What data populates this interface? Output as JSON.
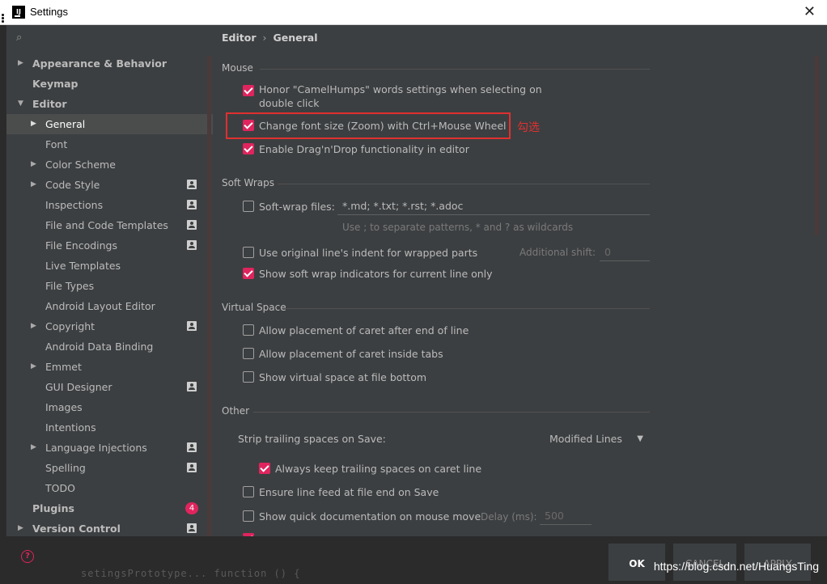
{
  "window": {
    "title": "Settings",
    "app_icon_letter": "IJ",
    "close_glyph": "✕"
  },
  "search": {
    "icon": "search-icon",
    "glyph": "⌕"
  },
  "sidebar": {
    "items": [
      {
        "label": "Appearance & Behavior"
      },
      {
        "label": "Keymap"
      },
      {
        "label": "Editor"
      },
      {
        "label": "General"
      },
      {
        "label": "Font"
      },
      {
        "label": "Color Scheme"
      },
      {
        "label": "Code Style"
      },
      {
        "label": "Inspections"
      },
      {
        "label": "File and Code Templates"
      },
      {
        "label": "File Encodings"
      },
      {
        "label": "Live Templates"
      },
      {
        "label": "File Types"
      },
      {
        "label": "Android Layout Editor"
      },
      {
        "label": "Copyright"
      },
      {
        "label": "Android Data Binding"
      },
      {
        "label": "Emmet"
      },
      {
        "label": "GUI Designer"
      },
      {
        "label": "Images"
      },
      {
        "label": "Intentions"
      },
      {
        "label": "Language Injections"
      },
      {
        "label": "Spelling"
      },
      {
        "label": "TODO"
      },
      {
        "label": "Plugins",
        "badge": "4"
      },
      {
        "label": "Version Control"
      }
    ]
  },
  "breadcrumb": {
    "part1": "Editor",
    "sep": "›",
    "part2": "General"
  },
  "mouse": {
    "title": "Mouse",
    "camelhumps_line1": "Honor \"CamelHumps\" words settings when selecting on",
    "camelhumps_line2": "double click",
    "zoom": "Change font size (Zoom) with Ctrl+Mouse Wheel",
    "dragdrop": "Enable Drag'n'Drop functionality in editor",
    "annotation": "勾选"
  },
  "soft_wraps": {
    "title": "Soft Wraps",
    "files_label": "Soft-wrap files:",
    "files_value": "*.md; *.txt; *.rst; *.adoc",
    "hint": "Use ; to separate patterns, * and ? as wildcards",
    "indent": "Use original line's indent for wrapped parts",
    "shift_label": "Additional shift:",
    "shift_value": "0",
    "indicators": "Show soft wrap indicators for current line only"
  },
  "virtual_space": {
    "title": "Virtual Space",
    "after_end": "Allow placement of caret after end of line",
    "inside_tabs": "Allow placement of caret inside tabs",
    "file_bottom": "Show virtual space at file bottom"
  },
  "other": {
    "title": "Other",
    "strip_label": "Strip trailing spaces on Save:",
    "strip_value": "Modified Lines",
    "keep_trailing": "Always keep trailing spaces on caret line",
    "line_feed": "Ensure line feed at file end on Save",
    "quick_doc": "Show quick documentation on mouse move",
    "delay_label": "Delay (ms):",
    "delay_value": "500"
  },
  "buttons": {
    "ok": "OK",
    "cancel": "CANCEL",
    "apply": "APPLY"
  },
  "background_code": "setingsPrototype...  function () {",
  "watermark": "https://blog.csdn.net/HuangsTing",
  "colors": {
    "accent": "#e0245e",
    "annotation_red": "#e03030",
    "panel": "#3c3f41"
  }
}
